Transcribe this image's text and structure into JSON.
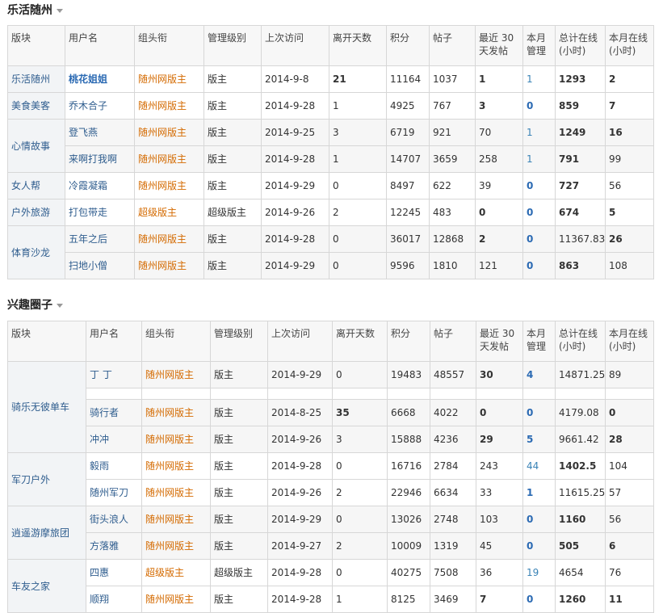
{
  "headers": [
    "版块",
    "用户名",
    "组头衔",
    "管理级别",
    "上次访问",
    "离开天数",
    "积分",
    "帖子",
    "最近 30 天发帖",
    "本月管理",
    "总计在线(小时)",
    "本月在线(小时)"
  ],
  "section1": {
    "title": "乐活随州",
    "rows": [
      {
        "forum": "乐活随州",
        "user": "桃花姐姐",
        "title": "随州网版主",
        "level": "版主",
        "last": "2014-9-8",
        "days": "21",
        "points": "11164",
        "posts": "1037",
        "recent": "1",
        "manage": "1",
        "total": "1293",
        "month": "2"
      },
      {
        "forum": "美食美客",
        "user": "乔木合子",
        "title": "随州网版主",
        "level": "版主",
        "last": "2014-9-28",
        "days": "1",
        "points": "4925",
        "posts": "767",
        "recent": "3",
        "manage": "0",
        "total": "859",
        "month": "7"
      },
      {
        "forum": "心情故事",
        "user": "登飞燕",
        "title": "随州网版主",
        "level": "版主",
        "last": "2014-9-25",
        "days": "3",
        "points": "6719",
        "posts": "921",
        "recent": "70",
        "manage": "1",
        "total": "1249",
        "month": "16"
      },
      {
        "forum": "",
        "user": "来啊打我啊",
        "title": "随州网版主",
        "level": "版主",
        "last": "2014-9-28",
        "days": "1",
        "points": "14707",
        "posts": "3659",
        "recent": "258",
        "manage": "1",
        "total": "791",
        "month": "99"
      },
      {
        "forum": "女人帮",
        "user": "冷霞凝霜",
        "title": "随州网版主",
        "level": "版主",
        "last": "2014-9-29",
        "days": "0",
        "points": "8497",
        "posts": "622",
        "recent": "39",
        "manage": "0",
        "total": "727",
        "month": "56"
      },
      {
        "forum": "户外旅游",
        "user": "打包带走",
        "title": "超级版主",
        "level": "超级版主",
        "last": "2014-9-26",
        "days": "2",
        "points": "12245",
        "posts": "483",
        "recent": "0",
        "manage": "0",
        "total": "674",
        "month": "5"
      },
      {
        "forum": "体育沙龙",
        "user": "五年之后",
        "title": "随州网版主",
        "level": "版主",
        "last": "2014-9-28",
        "days": "0",
        "points": "36017",
        "posts": "12868",
        "recent": "2",
        "manage": "0",
        "total": "11367.83",
        "month": "26"
      },
      {
        "forum": "",
        "user": "扫地小僧",
        "title": "随州网版主",
        "level": "版主",
        "last": "2014-9-29",
        "days": "0",
        "points": "9596",
        "posts": "1810",
        "recent": "121",
        "manage": "0",
        "total": "863",
        "month": "108"
      }
    ]
  },
  "section2": {
    "title": "兴趣圈子",
    "rows": [
      {
        "forum": "骑乐无彼单车",
        "user": "丁 丁",
        "title": "随州网版主",
        "level": "版主",
        "last": "2014-9-29",
        "days": "0",
        "points": "19483",
        "posts": "48557",
        "recent": "30",
        "manage": "4",
        "total": "14871.25",
        "month": "89"
      },
      {
        "forum": "",
        "user": "骑行者",
        "title": "随州网版主",
        "level": "版主",
        "last": "2014-8-25",
        "days": "35",
        "points": "6668",
        "posts": "4022",
        "recent": "0",
        "manage": "0",
        "total": "4179.08",
        "month": "0"
      },
      {
        "forum": "",
        "user": "冲冲",
        "title": "随州网版主",
        "level": "版主",
        "last": "2014-9-26",
        "days": "3",
        "points": "15888",
        "posts": "4236",
        "recent": "29",
        "manage": "5",
        "total": "9661.42",
        "month": "28"
      },
      {
        "forum": "军刀户外",
        "user": "毅雨",
        "title": "随州网版主",
        "level": "版主",
        "last": "2014-9-28",
        "days": "0",
        "points": "16716",
        "posts": "2784",
        "recent": "243",
        "manage": "44",
        "total": "1402.5",
        "month": "104"
      },
      {
        "forum": "",
        "user": "随州军刀",
        "title": "随州网版主",
        "level": "版主",
        "last": "2014-9-26",
        "days": "2",
        "points": "22946",
        "posts": "6634",
        "recent": "33",
        "manage": "1",
        "total": "11615.25",
        "month": "57"
      },
      {
        "forum": "逍遥游摩旅团",
        "user": "街头浪人",
        "title": "随州网版主",
        "level": "版主",
        "last": "2014-9-29",
        "days": "0",
        "points": "13026",
        "posts": "2748",
        "recent": "103",
        "manage": "0",
        "total": "1160",
        "month": "56"
      },
      {
        "forum": "",
        "user": "方落雅",
        "title": "随州网版主",
        "level": "版主",
        "last": "2014-9-27",
        "days": "2",
        "points": "10009",
        "posts": "1319",
        "recent": "45",
        "manage": "0",
        "total": "505",
        "month": "6"
      },
      {
        "forum": "车友之家",
        "user": "四惠",
        "title": "超级版主",
        "level": "超级版主",
        "last": "2014-9-28",
        "days": "0",
        "points": "40275",
        "posts": "7508",
        "recent": "36",
        "manage": "19",
        "total": "4654",
        "month": "76"
      },
      {
        "forum": "",
        "user": "顺翔",
        "title": "随州网版主",
        "level": "版主",
        "last": "2014-9-28",
        "days": "1",
        "points": "8125",
        "posts": "3469",
        "recent": "7",
        "manage": "0",
        "total": "1260",
        "month": "11"
      }
    ]
  }
}
